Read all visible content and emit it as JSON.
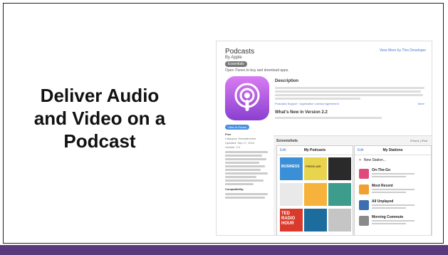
{
  "slide": {
    "title_lines": [
      "Deliver Audio",
      "and Video on a",
      "Podcast"
    ]
  },
  "store": {
    "app_name": "Podcasts",
    "developer": "By Apple",
    "badge": "Essentials",
    "open_itunes": "Open iTunes to buy and download apps.",
    "dev_link": "View More by This Developer",
    "description_title": "Description",
    "support_links": "Podcasts Support  ·  Application License Agreement",
    "more": "More",
    "whats_new_title": "What's New in Version 2.2",
    "view_in_itunes": "View in iTunes",
    "meta": {
      "free": "Free",
      "category": "Category: Entertainment",
      "updated": "Updated: Sep 17, 2014",
      "version": "Version: 2.2",
      "compatibility": "Compatibility:"
    },
    "screenshots_label": "Screenshots",
    "device_toggle": "iPhone | iPad",
    "left_screen": {
      "edit": "Edit",
      "title": "My Podcasts",
      "tiles": [
        "BUSINESS",
        "FRESH AIR",
        "",
        "",
        "TED RADIO HOUR",
        "",
        "",
        ""
      ]
    },
    "right_screen": {
      "edit": "Edit",
      "title": "My Stations",
      "new_station": "New Station...",
      "stations": [
        "On-The-Go",
        "Most Recent",
        "All Unplayed",
        "Morning Commute"
      ]
    }
  },
  "colors": {
    "footer": "#5a3a7a",
    "icon_top": "#d97cf3",
    "icon_bottom": "#8a3fd0",
    "link": "#4a7bd0"
  }
}
